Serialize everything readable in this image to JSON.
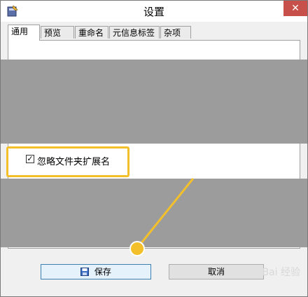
{
  "window": {
    "title": "设置",
    "close_label": "✕"
  },
  "tabs": [
    {
      "label": "通用",
      "active": true
    },
    {
      "label": "预览",
      "active": false
    },
    {
      "label": "重命名",
      "active": false
    },
    {
      "label": "元信息标签",
      "active": false
    },
    {
      "label": "杂项",
      "active": false
    }
  ],
  "options": {
    "ignore_folder_extension": {
      "label": "忽略文件夹扩展名",
      "checked": true,
      "check_glyph": "✓"
    }
  },
  "buttons": {
    "save_label": "保存",
    "cancel_label": "取消"
  },
  "watermark": {
    "text": "Bai 经验"
  },
  "colors": {
    "highlight": "#f3c02c",
    "close_button": "#c7504a",
    "default_button_border": "#3c7fb1"
  }
}
